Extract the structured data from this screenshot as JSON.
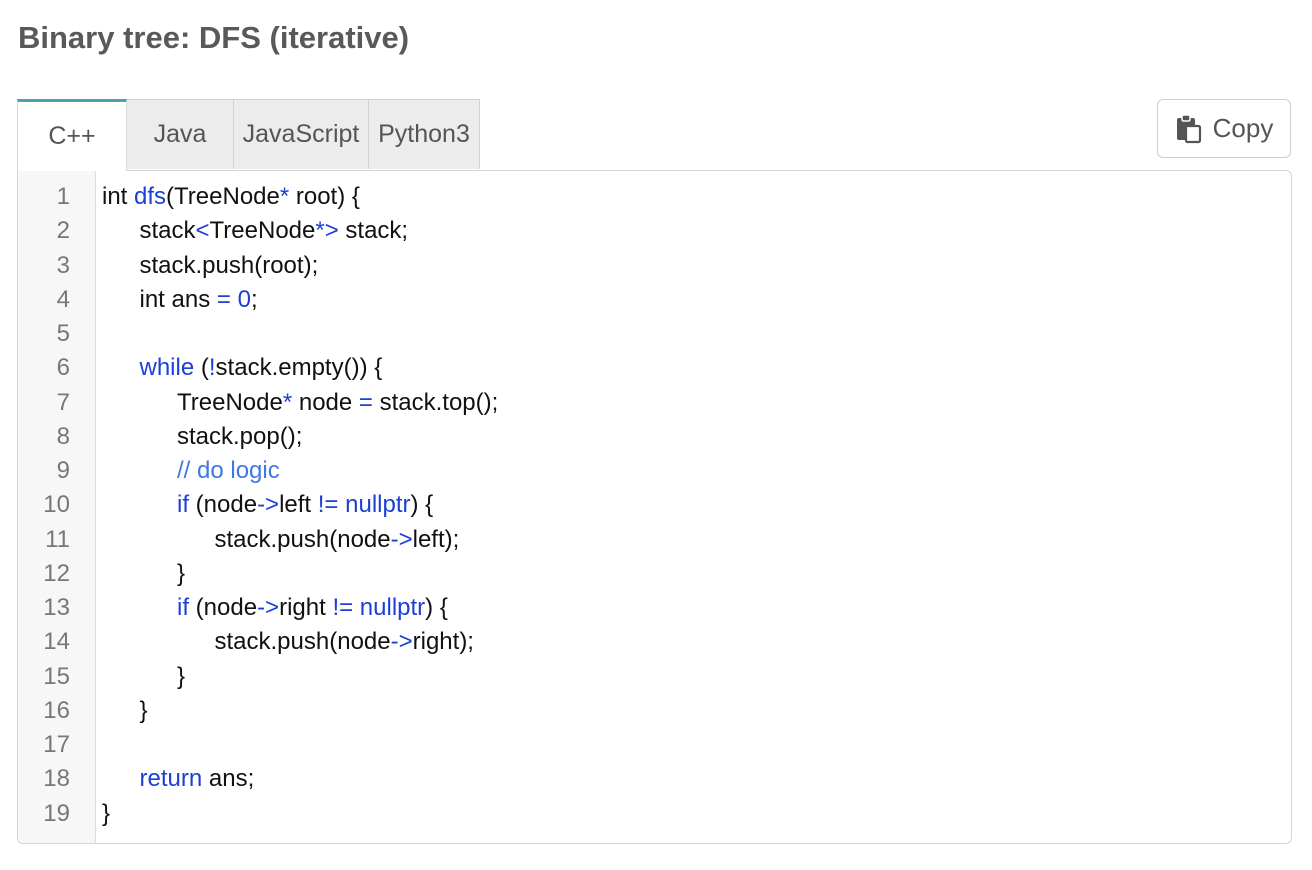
{
  "page": {
    "title": "Binary tree: DFS (iterative)"
  },
  "tabs": [
    {
      "label": "C++",
      "active": true
    },
    {
      "label": "Java",
      "active": false
    },
    {
      "label": "JavaScript",
      "active": false
    },
    {
      "label": "Python3",
      "active": false
    }
  ],
  "toolbar": {
    "copy_label": "Copy",
    "copy_icon": "clipboard-icon"
  },
  "colors": {
    "accent_tab": "#4aa3a6",
    "keyword": "#1c3fd6",
    "comment": "#3f78e0",
    "text": "#111111"
  },
  "code": {
    "language": "C++",
    "lines": [
      {
        "num": "1",
        "indent": 0,
        "tokens": [
          {
            "t": "int ",
            "c": "plain"
          },
          {
            "t": "dfs",
            "c": "fn"
          },
          {
            "t": "(TreeNode",
            "c": "plain"
          },
          {
            "t": "*",
            "c": "op"
          },
          {
            "t": " root) {",
            "c": "plain"
          }
        ]
      },
      {
        "num": "2",
        "indent": 1,
        "tokens": [
          {
            "t": "stack",
            "c": "plain"
          },
          {
            "t": "<",
            "c": "op"
          },
          {
            "t": "TreeNode",
            "c": "plain"
          },
          {
            "t": "*>",
            "c": "op"
          },
          {
            "t": " stack;",
            "c": "plain"
          }
        ]
      },
      {
        "num": "3",
        "indent": 1,
        "tokens": [
          {
            "t": "stack.push(root);",
            "c": "plain"
          }
        ]
      },
      {
        "num": "4",
        "indent": 1,
        "tokens": [
          {
            "t": "int ans ",
            "c": "plain"
          },
          {
            "t": "=",
            "c": "op"
          },
          {
            "t": " ",
            "c": "plain"
          },
          {
            "t": "0",
            "c": "num"
          },
          {
            "t": ";",
            "c": "plain"
          }
        ]
      },
      {
        "num": "5",
        "indent": 0,
        "tokens": []
      },
      {
        "num": "6",
        "indent": 1,
        "tokens": [
          {
            "t": "while",
            "c": "kw"
          },
          {
            "t": " (",
            "c": "plain"
          },
          {
            "t": "!",
            "c": "op"
          },
          {
            "t": "stack.empty()) {",
            "c": "plain"
          }
        ]
      },
      {
        "num": "7",
        "indent": 2,
        "tokens": [
          {
            "t": "TreeNode",
            "c": "plain"
          },
          {
            "t": "*",
            "c": "op"
          },
          {
            "t": " node ",
            "c": "plain"
          },
          {
            "t": "=",
            "c": "op"
          },
          {
            "t": " stack.top();",
            "c": "plain"
          }
        ]
      },
      {
        "num": "8",
        "indent": 2,
        "tokens": [
          {
            "t": "stack.pop();",
            "c": "plain"
          }
        ]
      },
      {
        "num": "9",
        "indent": 2,
        "tokens": [
          {
            "t": "// do logic",
            "c": "cm"
          }
        ]
      },
      {
        "num": "10",
        "indent": 2,
        "tokens": [
          {
            "t": "if",
            "c": "kw"
          },
          {
            "t": " (node",
            "c": "plain"
          },
          {
            "t": "->",
            "c": "op"
          },
          {
            "t": "left ",
            "c": "plain"
          },
          {
            "t": "!=",
            "c": "op"
          },
          {
            "t": " ",
            "c": "plain"
          },
          {
            "t": "nullptr",
            "c": "kw"
          },
          {
            "t": ") {",
            "c": "plain"
          }
        ]
      },
      {
        "num": "11",
        "indent": 3,
        "tokens": [
          {
            "t": "stack.push(node",
            "c": "plain"
          },
          {
            "t": "->",
            "c": "op"
          },
          {
            "t": "left);",
            "c": "plain"
          }
        ]
      },
      {
        "num": "12",
        "indent": 2,
        "tokens": [
          {
            "t": "}",
            "c": "plain"
          }
        ]
      },
      {
        "num": "13",
        "indent": 2,
        "tokens": [
          {
            "t": "if",
            "c": "kw"
          },
          {
            "t": " (node",
            "c": "plain"
          },
          {
            "t": "->",
            "c": "op"
          },
          {
            "t": "right ",
            "c": "plain"
          },
          {
            "t": "!=",
            "c": "op"
          },
          {
            "t": " ",
            "c": "plain"
          },
          {
            "t": "nullptr",
            "c": "kw"
          },
          {
            "t": ") {",
            "c": "plain"
          }
        ]
      },
      {
        "num": "14",
        "indent": 3,
        "tokens": [
          {
            "t": "stack.push(node",
            "c": "plain"
          },
          {
            "t": "->",
            "c": "op"
          },
          {
            "t": "right);",
            "c": "plain"
          }
        ]
      },
      {
        "num": "15",
        "indent": 2,
        "tokens": [
          {
            "t": "}",
            "c": "plain"
          }
        ]
      },
      {
        "num": "16",
        "indent": 1,
        "tokens": [
          {
            "t": "}",
            "c": "plain"
          }
        ]
      },
      {
        "num": "17",
        "indent": 0,
        "tokens": []
      },
      {
        "num": "18",
        "indent": 1,
        "tokens": [
          {
            "t": "return",
            "c": "kw"
          },
          {
            "t": " ans;",
            "c": "plain"
          }
        ]
      },
      {
        "num": "19",
        "indent": 0,
        "tokens": [
          {
            "t": "}",
            "c": "plain"
          }
        ]
      }
    ]
  }
}
